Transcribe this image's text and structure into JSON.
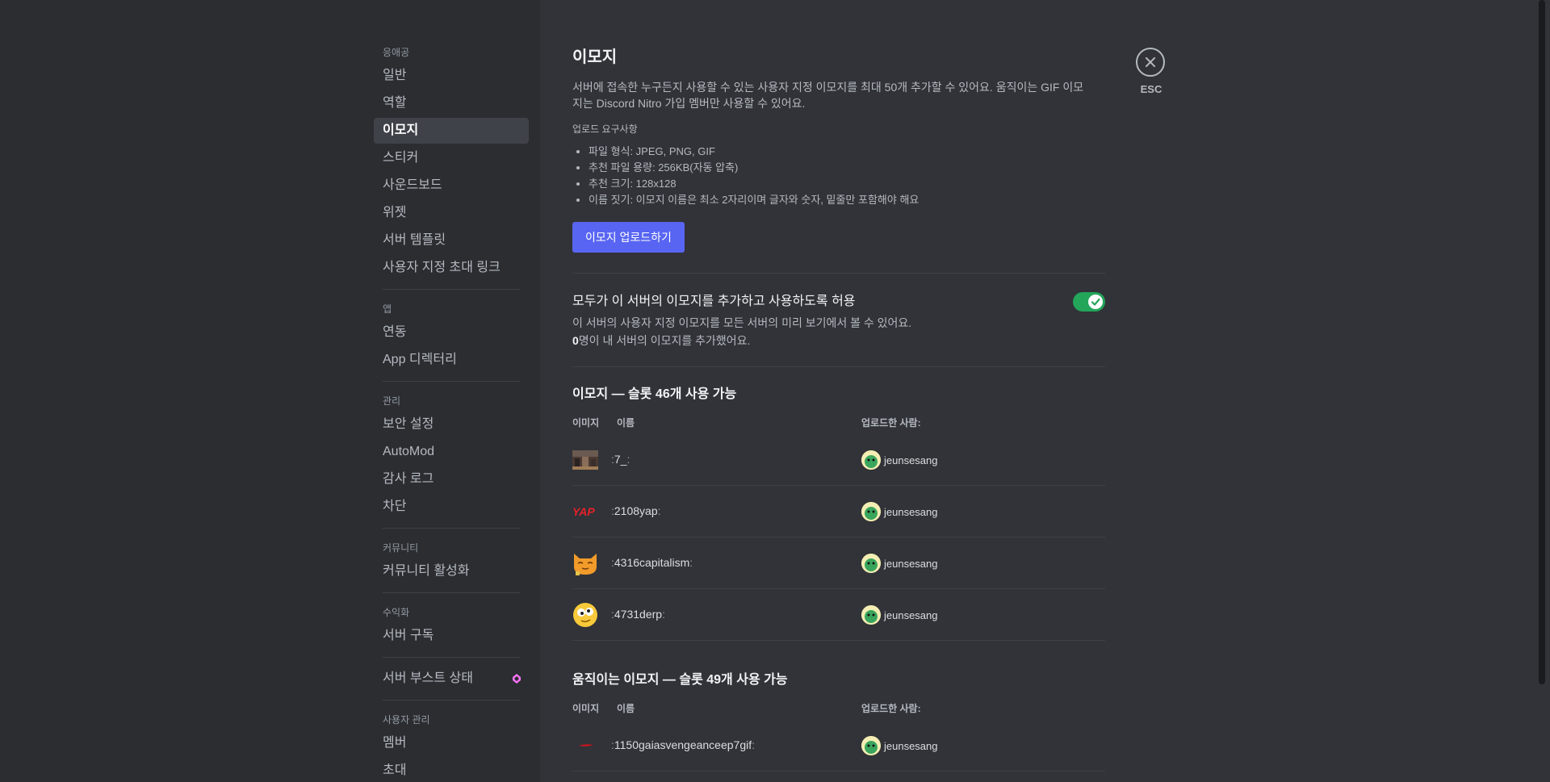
{
  "sidebar": {
    "sections": [
      {
        "header": "응애공",
        "items": [
          {
            "label": "일반"
          },
          {
            "label": "역할"
          },
          {
            "label": "이모지",
            "active": true
          },
          {
            "label": "스티커"
          },
          {
            "label": "사운드보드"
          },
          {
            "label": "위젯"
          },
          {
            "label": "서버 템플릿"
          },
          {
            "label": "사용자 지정 초대 링크"
          }
        ]
      },
      {
        "header": "앱",
        "items": [
          {
            "label": "연동"
          },
          {
            "label": "App 디렉터리"
          }
        ]
      },
      {
        "header": "관리",
        "items": [
          {
            "label": "보안 설정"
          },
          {
            "label": "AutoMod"
          },
          {
            "label": "감사 로그"
          },
          {
            "label": "차단"
          }
        ]
      },
      {
        "header": "커뮤니티",
        "items": [
          {
            "label": "커뮤니티 활성화"
          }
        ]
      },
      {
        "header": "수익화",
        "items": [
          {
            "label": "서버 구독"
          }
        ]
      },
      {
        "header": "",
        "items": [
          {
            "label": "서버 부스트 상태",
            "icon": "boost-gem-icon"
          }
        ]
      },
      {
        "header": "사용자 관리",
        "items": [
          {
            "label": "멤버"
          },
          {
            "label": "초대"
          }
        ]
      }
    ]
  },
  "main": {
    "title": "이모지",
    "description": "서버에 접속한 누구든지 사용할 수 있는 사용자 지정 이모지를 최대 50개 추가할 수 있어요. 움직이는 GIF 이모지는 Discord Nitro 가입 멤버만 사용할 수 있어요.",
    "requirements_header": "업로드 요구사항",
    "requirements": [
      "파일 형식: JPEG, PNG, GIF",
      "추천 파일 용량: 256KB(자동 압축)",
      "추천 크기: 128x128",
      "이름 짓기: 이모지 이름은 최소 2자리이며 글자와 숫자, 밑줄만 포함해야 해요"
    ],
    "upload_button": "이모지 업로드하기",
    "toggle": {
      "title": "모두가 이 서버의 이모지를 추가하고 사용하도록 허용",
      "desc_line1": "이 서버의 사용자 지정 이모지를 모든 서버의 미리 보기에서 볼 수 있어요.",
      "count": "0",
      "desc_line2_suffix": "명이 내 서버의 이모지를 추가했어요.",
      "enabled": true,
      "color": "#23a55a"
    },
    "static_section": {
      "title": "이모지 — 슬롯 46개 사용 가능",
      "col_image": "이미지",
      "col_name": "이름",
      "col_uploader": "업로드한 사람:",
      "rows": [
        {
          "name": "7_",
          "uploader": "jeunsesang",
          "icon": "photo-thumbnail-icon"
        },
        {
          "name": "2108yap",
          "uploader": "jeunsesang",
          "icon": "yap-text-icon"
        },
        {
          "name": "4316capitalism",
          "uploader": "jeunsesang",
          "icon": "orange-cat-icon"
        },
        {
          "name": "4731derp",
          "uploader": "jeunsesang",
          "icon": "derp-face-icon"
        }
      ]
    },
    "animated_section": {
      "title": "움직이는 이모지 — 슬롯 49개 사용 가능",
      "col_image": "이미지",
      "col_name": "이름",
      "col_uploader": "업로드한 사람:",
      "rows": [
        {
          "name": "1150gaiasvengeanceep7gif",
          "uploader": "jeunsesang",
          "icon": "red-streak-icon"
        }
      ]
    }
  },
  "close": {
    "label": "ESC"
  },
  "colors": {
    "accent": "#5865f2",
    "boost": "#ff73fa"
  }
}
